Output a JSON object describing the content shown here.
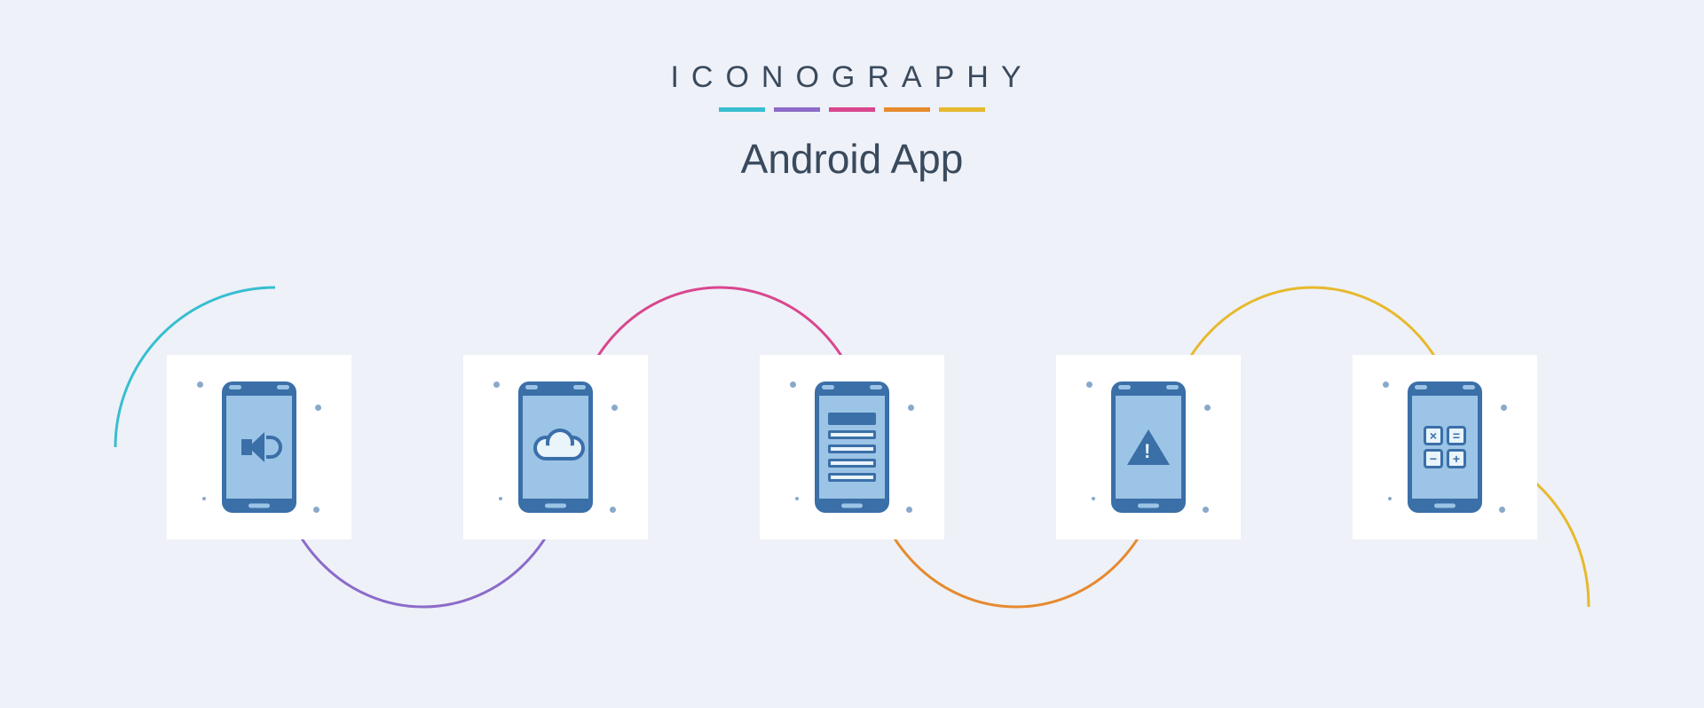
{
  "header": {
    "brand": "ICONOGRAPHY",
    "title": "Android App",
    "accent_colors": [
      "#37bed0",
      "#8c6bc9",
      "#d9468f",
      "#e68a2e",
      "#e6b92e"
    ]
  },
  "wave_colors": [
    "#37bed0",
    "#8c6bc9",
    "#d9468f",
    "#e68a2e",
    "#e6b92e"
  ],
  "icons": [
    {
      "name": "phone-volume-icon",
      "glyph": "speaker"
    },
    {
      "name": "phone-weather-icon",
      "glyph": "cloud"
    },
    {
      "name": "phone-list-icon",
      "glyph": "list"
    },
    {
      "name": "phone-alert-icon",
      "glyph": "alert"
    },
    {
      "name": "phone-calculator-icon",
      "glyph": "calc"
    }
  ],
  "calc_symbols": [
    "×",
    "=",
    "−",
    "+"
  ]
}
